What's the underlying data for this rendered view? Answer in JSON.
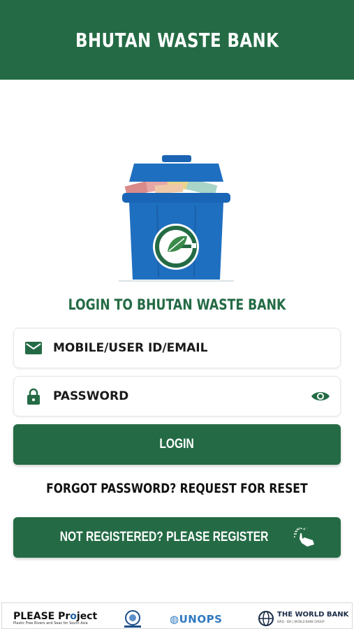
{
  "header": {
    "title": "BHUTAN WASTE BANK"
  },
  "main": {
    "login_heading": "LOGIN TO BHUTAN WASTE BANK",
    "user_field": {
      "placeholder": "MOBILE/USER ID/EMAIL",
      "icon": "email-icon"
    },
    "password_field": {
      "placeholder": "PASSWORD",
      "icon": "lock-icon",
      "toggle_icon": "eye-icon"
    },
    "login_button": "LOGIN",
    "forgot_link": "FORGOT PASSWORD? REQUEST FOR RESET",
    "register_button": "NOT REGISTERED? PLEASE REGISTER",
    "register_icon": "tap-hand-icon"
  },
  "footer": {
    "please_project": {
      "name_prefix": "PLEASE Pr",
      "name_suffix": "ject",
      "tagline": "Plastic Free Rivers and Seas for South Asia"
    },
    "unops": "UNOPS",
    "world_bank": {
      "name": "THE WORLD BANK",
      "sub": "IBRD · IDA | WORLD BANK GROUP"
    }
  },
  "colors": {
    "brand_green": "#246b45",
    "bin_blue": "#1f6fc0"
  }
}
